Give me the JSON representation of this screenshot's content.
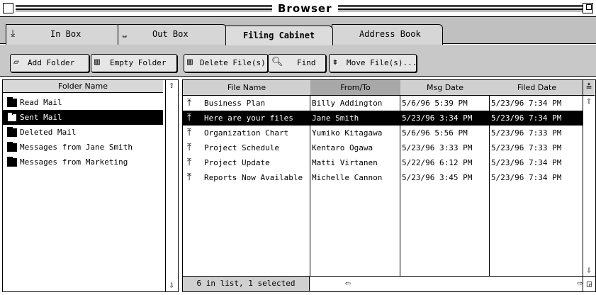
{
  "window": {
    "title": "Browser"
  },
  "tabs": [
    {
      "label": "In Box",
      "icon": "inbox-arrow-icon"
    },
    {
      "label": "Out Box",
      "icon": "outbox-tray-icon"
    },
    {
      "label": "Filing Cabinet",
      "icon": ""
    },
    {
      "label": "Address Book",
      "icon": ""
    }
  ],
  "toolbar": [
    {
      "label": "Add Folder",
      "icon": "open-folder-icon"
    },
    {
      "label": "Empty Folder",
      "icon": "trash-icon"
    },
    {
      "label": "Delete File(s)",
      "icon": "trash-icon"
    },
    {
      "label": "Find",
      "icon": "magnifier-icon"
    },
    {
      "label": "Move File(s)...",
      "icon": "move-icon"
    }
  ],
  "folders": {
    "header": "Folder Name",
    "items": [
      {
        "label": "Read Mail",
        "selected": false
      },
      {
        "label": "Sent Mail",
        "selected": true
      },
      {
        "label": "Deleted Mail",
        "selected": false
      },
      {
        "label": "Messages from Jane Smith",
        "selected": false
      },
      {
        "label": "Messages from Marketing",
        "selected": false
      }
    ]
  },
  "files": {
    "columns": [
      "File Name",
      "From/To",
      "Msg Date",
      "Filed Date"
    ],
    "sorted_column": "File Name",
    "rows": [
      {
        "name": "Business Plan",
        "from": "Billy Addington",
        "msg_date": "5/6/96 5:39 PM",
        "filed_date": "5/23/96 7:34 PM",
        "selected": false
      },
      {
        "name": "Here are your files",
        "from": "Jane Smith",
        "msg_date": "5/23/96 3:34 PM",
        "filed_date": "5/23/96 7:34 PM",
        "selected": true
      },
      {
        "name": "Organization Chart",
        "from": "Yumiko Kitagawa",
        "msg_date": "5/6/96 5:56 PM",
        "filed_date": "5/23/96 7:33 PM",
        "selected": false
      },
      {
        "name": "Project Schedule",
        "from": "Kentaro Ogawa",
        "msg_date": "5/23/96 3:33 PM",
        "filed_date": "5/23/96 7:33 PM",
        "selected": false
      },
      {
        "name": "Project Update",
        "from": "Matti Virtanen",
        "msg_date": "5/22/96 6:12 PM",
        "filed_date": "5/23/96 7:34 PM",
        "selected": false
      },
      {
        "name": "Reports Now Available",
        "from": "Michelle Cannon",
        "msg_date": "5/23/96 3:45 PM",
        "filed_date": "5/23/96 7:34 PM",
        "selected": false
      }
    ],
    "status": "6 in list, 1 selected"
  }
}
